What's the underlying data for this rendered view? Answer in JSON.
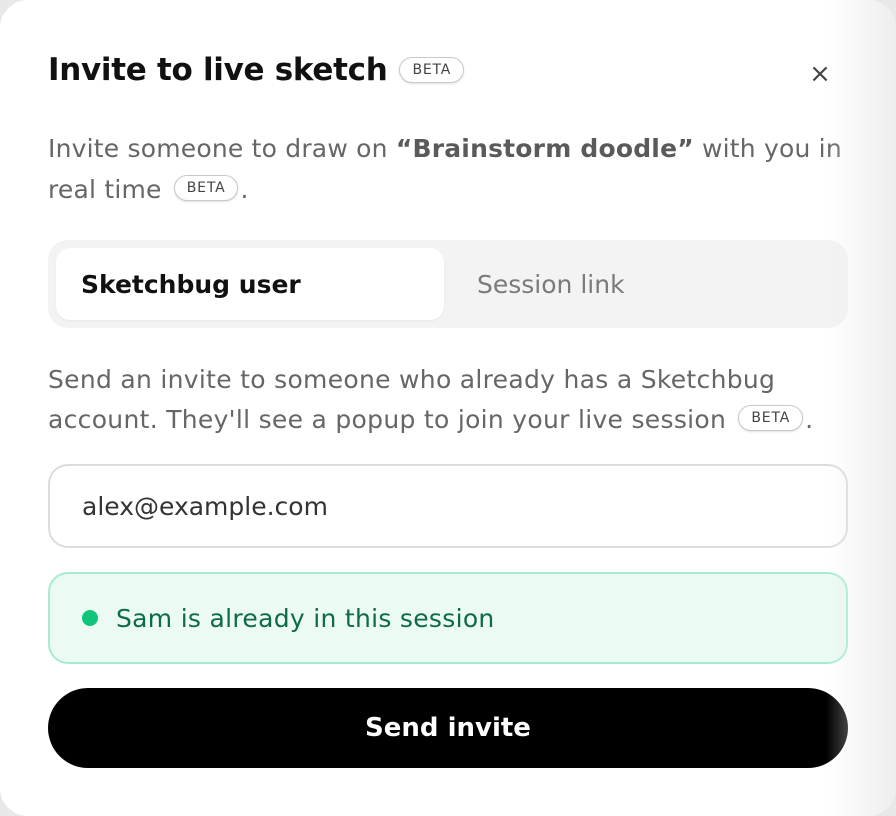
{
  "dialog": {
    "title": "Invite to live sketch",
    "badge": "BETA",
    "close_icon": "×"
  },
  "intro": {
    "prefix": "Invite someone to draw on ",
    "doc_name": "“Brainstorm doodle”",
    "suffix": " with you in real time",
    "badge": "BETA",
    "end": "."
  },
  "tabs": [
    {
      "label": "Sketchbug user",
      "active": true
    },
    {
      "label": "Session link",
      "active": false
    }
  ],
  "description": {
    "text": "Send an invite to someone who already has a Sketchbug account. They'll see a popup to join your live session",
    "badge": "BETA",
    "end": "."
  },
  "email_input": {
    "value": "alex@example.com"
  },
  "status": {
    "text": "Sam is already in this session",
    "dot_color": "#10c47a"
  },
  "send_button": {
    "label": "Send invite"
  },
  "colors": {
    "accent_green": "#10c47a",
    "status_bg": "#ebfbf3",
    "button_bg": "#000000"
  }
}
